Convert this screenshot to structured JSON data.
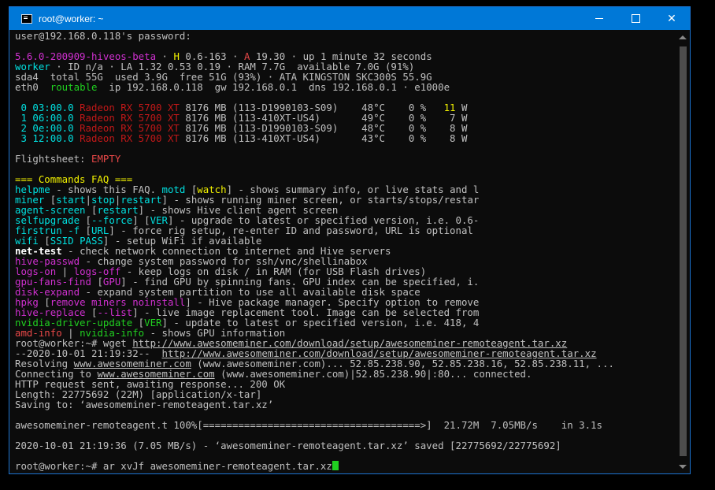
{
  "window": {
    "title": "root@worker: ~"
  },
  "lines": [
    [
      {
        "t": "user@192.168.0.118's password:",
        "c": "w"
      }
    ],
    [],
    [
      {
        "t": "5.6.0-200909-hiveos-beta",
        "c": "m"
      },
      {
        "t": " · ",
        "c": "w"
      },
      {
        "t": "H",
        "c": "y"
      },
      {
        "t": " 0.6-163 · ",
        "c": "w"
      },
      {
        "t": "A",
        "c": "r"
      },
      {
        "t": " 19.30 · up 1 minute 32 seconds",
        "c": "w"
      }
    ],
    [
      {
        "t": "worker",
        "c": "c"
      },
      {
        "t": " · ID n/a · LA 1.32 0.53 0.19 · RAM 7.7G  available 7.0G (91%)",
        "c": "w"
      }
    ],
    [
      {
        "t": "sda4  total 55G  used 3.9G  free 51G (93%) · ATA KINGSTON SKC300S 55.9G",
        "c": "w"
      }
    ],
    [
      {
        "t": "eth0  ",
        "c": "w"
      },
      {
        "t": "routable",
        "c": "g"
      },
      {
        "t": "  ip 192.168.0.118  gw 192.168.0.1  dns 192.168.0.1 · e1000e",
        "c": "w"
      }
    ],
    [],
    [
      {
        "t": " 0 03:00.0 ",
        "c": "c"
      },
      {
        "t": "Radeon RX 5700 XT",
        "c": "dr"
      },
      {
        "t": " 8176 MB (113-D1990103-S09)    48°C    0 %   ",
        "c": "w"
      },
      {
        "t": "11",
        "c": "y"
      },
      {
        "t": " W",
        "c": "w"
      }
    ],
    [
      {
        "t": " 1 06:00.0 ",
        "c": "c"
      },
      {
        "t": "Radeon RX 5700 XT",
        "c": "dr"
      },
      {
        "t": " 8176 MB (113-410XT-US4)       49°C    0 %    7 W",
        "c": "w"
      }
    ],
    [
      {
        "t": " 2 0e:00.0 ",
        "c": "c"
      },
      {
        "t": "Radeon RX 5700 XT",
        "c": "dr"
      },
      {
        "t": " 8176 MB (113-D1990103-S09)    48°C    0 %    8 W",
        "c": "w"
      }
    ],
    [
      {
        "t": " 3 12:00.0 ",
        "c": "c"
      },
      {
        "t": "Radeon RX 5700 XT",
        "c": "dr"
      },
      {
        "t": " 8176 MB (113-410XT-US4)       43°C    0 %    8 W",
        "c": "w"
      }
    ],
    [],
    [
      {
        "t": "Flightsheet: ",
        "c": "w"
      },
      {
        "t": "EMPTY",
        "c": "r"
      }
    ],
    [],
    [
      {
        "t": "=== Commands FAQ ===",
        "c": "y"
      }
    ],
    [
      {
        "t": "helpme",
        "c": "c"
      },
      {
        "t": " - shows this FAQ. ",
        "c": "w"
      },
      {
        "t": "motd",
        "c": "c"
      },
      {
        "t": " [",
        "c": "w"
      },
      {
        "t": "watch",
        "c": "y"
      },
      {
        "t": "] - shows summary info, or live stats and l",
        "c": "w"
      }
    ],
    [
      {
        "t": "miner",
        "c": "c"
      },
      {
        "t": " [",
        "c": "w"
      },
      {
        "t": "start",
        "c": "c"
      },
      {
        "t": "|",
        "c": "w"
      },
      {
        "t": "stop",
        "c": "c"
      },
      {
        "t": "|",
        "c": "w"
      },
      {
        "t": "restart",
        "c": "c"
      },
      {
        "t": "] - shows running miner screen, or starts/stops/restar",
        "c": "w"
      }
    ],
    [
      {
        "t": "agent-screen",
        "c": "c"
      },
      {
        "t": " [",
        "c": "w"
      },
      {
        "t": "restart",
        "c": "c"
      },
      {
        "t": "] - shows Hive client agent screen",
        "c": "w"
      }
    ],
    [
      {
        "t": "selfupgrade",
        "c": "c"
      },
      {
        "t": " [",
        "c": "w"
      },
      {
        "t": "--force",
        "c": "c"
      },
      {
        "t": "] [",
        "c": "w"
      },
      {
        "t": "VER",
        "c": "c"
      },
      {
        "t": "] - upgrade to latest or specified version, i.e. 0.6-",
        "c": "w"
      }
    ],
    [
      {
        "t": "firstrun -f",
        "c": "c"
      },
      {
        "t": " [",
        "c": "w"
      },
      {
        "t": "URL",
        "c": "c"
      },
      {
        "t": "] - force rig setup, re-enter ID and password, URL is optional",
        "c": "w"
      }
    ],
    [
      {
        "t": "wifi",
        "c": "c"
      },
      {
        "t": " [",
        "c": "w"
      },
      {
        "t": "SSID PASS",
        "c": "c"
      },
      {
        "t": "] - setup WiFi if available",
        "c": "w"
      }
    ],
    [
      {
        "t": "net-test",
        "c": "b"
      },
      {
        "t": " - check network connection to internet and Hive servers",
        "c": "w"
      }
    ],
    [
      {
        "t": "hive-passwd",
        "c": "m"
      },
      {
        "t": " - change system password for ssh/vnc/shellinabox",
        "c": "w"
      }
    ],
    [
      {
        "t": "logs-on",
        "c": "m"
      },
      {
        "t": " | ",
        "c": "w"
      },
      {
        "t": "logs-off",
        "c": "m"
      },
      {
        "t": " - keep logs on disk / in RAM (for USB Flash drives)",
        "c": "w"
      }
    ],
    [
      {
        "t": "gpu-fans-find",
        "c": "m"
      },
      {
        "t": " [",
        "c": "w"
      },
      {
        "t": "GPU",
        "c": "m"
      },
      {
        "t": "] - find GPU by spinning fans. GPU index can be specified, i.",
        "c": "w"
      }
    ],
    [
      {
        "t": "disk-expand",
        "c": "m"
      },
      {
        "t": " - expand system partition to use all available disk space",
        "c": "w"
      }
    ],
    [
      {
        "t": "hpkg",
        "c": "m"
      },
      {
        "t": " [",
        "c": "w"
      },
      {
        "t": "remove miners noinstall",
        "c": "m"
      },
      {
        "t": "] - Hive package manager. Specify option to remove",
        "c": "w"
      }
    ],
    [
      {
        "t": "hive-replace",
        "c": "m"
      },
      {
        "t": " [",
        "c": "w"
      },
      {
        "t": "--list",
        "c": "m"
      },
      {
        "t": "] - live image replacement tool. Image can be selected from",
        "c": "w"
      }
    ],
    [
      {
        "t": "nvidia-driver-update",
        "c": "g"
      },
      {
        "t": " [",
        "c": "w"
      },
      {
        "t": "VER",
        "c": "g"
      },
      {
        "t": "] - update to latest or specified version, i.e. 418, 4",
        "c": "w"
      }
    ],
    [
      {
        "t": "amd-info",
        "c": "r"
      },
      {
        "t": " | ",
        "c": "w"
      },
      {
        "t": "nvidia-info",
        "c": "g"
      },
      {
        "t": " - shows GPU information",
        "c": "w"
      }
    ],
    [
      {
        "t": "root@worker:~# wget ",
        "c": "w"
      },
      {
        "t": "http://www.awesomeminer.com/download/setup/awesomeminer-remoteagent.tar.xz",
        "c": "u"
      }
    ],
    [
      {
        "t": "--2020-10-01 21:19:32--  ",
        "c": "w"
      },
      {
        "t": "http://www.awesomeminer.com/download/setup/awesomeminer-remoteagent.tar.xz",
        "c": "u"
      }
    ],
    [
      {
        "t": "Resolving ",
        "c": "w"
      },
      {
        "t": "www.awesomeminer.com",
        "c": "u"
      },
      {
        "t": " (www.awesomeminer.com)... 52.85.238.90, 52.85.238.16, 52.85.238.11, ...",
        "c": "w"
      }
    ],
    [
      {
        "t": "Connecting to ",
        "c": "w"
      },
      {
        "t": "www.awesomeminer.com",
        "c": "u"
      },
      {
        "t": " (www.awesomeminer.com)|52.85.238.90|:80... connected.",
        "c": "w"
      }
    ],
    [
      {
        "t": "HTTP request sent, awaiting response... 200 OK",
        "c": "w"
      }
    ],
    [
      {
        "t": "Length: 22775692 (22M) [application/x-tar]",
        "c": "w"
      }
    ],
    [
      {
        "t": "Saving to: ‘awesomeminer-remoteagent.tar.xz’",
        "c": "w"
      }
    ],
    [],
    [
      {
        "t": "awesomeminer-remoteagent.t 100%[=====================================>]  21.72M  7.05MB/s    in 3.1s",
        "c": "w"
      }
    ],
    [],
    [
      {
        "t": "2020-10-01 21:19:36 (7.05 MB/s) - ‘awesomeminer-remoteagent.tar.xz’ saved [22775692/22775692]",
        "c": "w"
      }
    ],
    [],
    [
      {
        "t": "root@worker:~# ar xvJf awesomeminer-remoteagent.tar.xz",
        "c": "w"
      },
      {
        "t": "",
        "c": "cursor"
      }
    ]
  ]
}
